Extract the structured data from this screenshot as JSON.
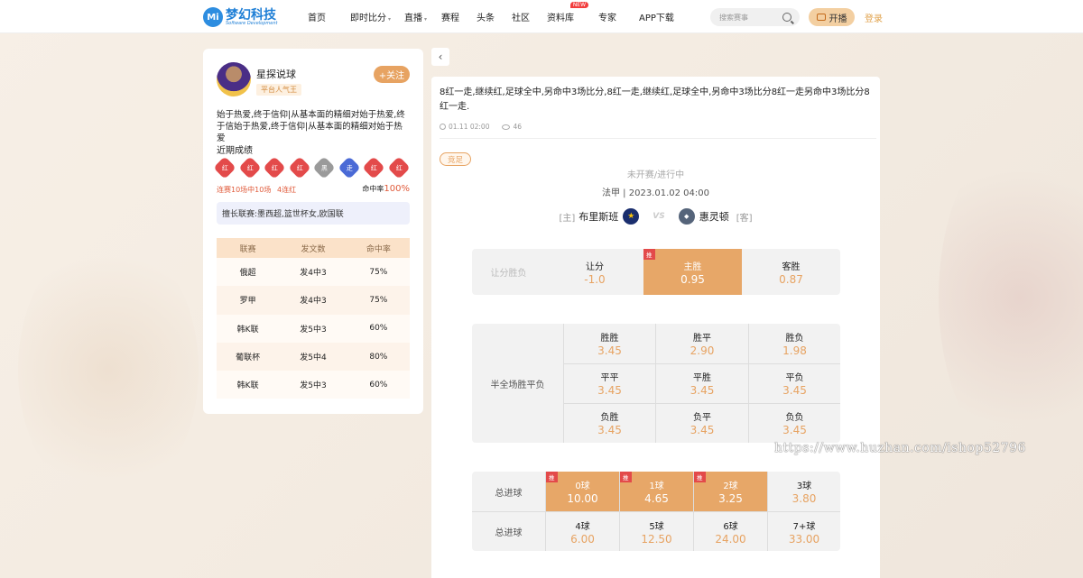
{
  "header": {
    "logo_cn": "梦幻科技",
    "logo_en": "Software Development",
    "logo_mark": "Mi",
    "nav": [
      {
        "label": "首页",
        "caret": false,
        "badge": ""
      },
      {
        "label": "即时比分",
        "caret": true,
        "badge": ""
      },
      {
        "label": "直播",
        "caret": true,
        "badge": ""
      },
      {
        "label": "赛程",
        "caret": false,
        "badge": ""
      },
      {
        "label": "头条",
        "caret": false,
        "badge": ""
      },
      {
        "label": "社区",
        "caret": false,
        "badge": ""
      },
      {
        "label": "资料库",
        "caret": false,
        "badge": "NEW"
      },
      {
        "label": "专家",
        "caret": false,
        "badge": ""
      },
      {
        "label": "APP下载",
        "caret": false,
        "badge": ""
      }
    ],
    "search_placeholder": "搜索赛事",
    "live_label": "开播",
    "login_label": "登录"
  },
  "author": {
    "name": "星探说球",
    "tag": "平台人气王",
    "follow_label": "+关注",
    "bio": "始于热爱,终于信仰|从基本面的精细对始于热爱,终于信始于热爱,终于信仰|从基本面的精细对始于热爱",
    "recent_title": "近期成绩",
    "recent_results": [
      {
        "label": "红",
        "color": "red"
      },
      {
        "label": "红",
        "color": "red"
      },
      {
        "label": "红",
        "color": "red"
      },
      {
        "label": "红",
        "color": "red"
      },
      {
        "label": "黑",
        "color": "gray"
      },
      {
        "label": "走",
        "color": "blue"
      },
      {
        "label": "红",
        "color": "red"
      },
      {
        "label": "红",
        "color": "red"
      }
    ],
    "streak_text": "连赛10场中10场",
    "consecutive_text": "4连红",
    "hit_rate_label": "命中率",
    "hit_rate_value": "100%",
    "leagues_text": "擅长联赛:墨西超,篮世杯女,欧国联",
    "table_headers": [
      "联赛",
      "发文数",
      "命中率"
    ],
    "table_rows": [
      [
        "俄超",
        "发4中3",
        "75%"
      ],
      [
        "罗甲",
        "发4中3",
        "75%"
      ],
      [
        "韩K联",
        "发5中3",
        "60%"
      ],
      [
        "葡联杯",
        "发5中4",
        "80%"
      ],
      [
        "韩K联",
        "发5中3",
        "60%"
      ]
    ]
  },
  "article": {
    "back_icon": "‹",
    "text": "8红一走,继续红,足球全中,另命中3场比分,8红一走,继续红,足球全中,另命中3场比分8红一走另命中3场比分8红一走.",
    "date": "01.11 02:00",
    "views": "46",
    "type_badge": "竞足",
    "status": "未开赛/进行中",
    "league_time": "法甲 | 2023.01.02 04:00",
    "home_tag": "[主]",
    "home_team": "布里斯班",
    "away_team": "惠灵顿",
    "away_tag": "[客]",
    "vs_label": "VS"
  },
  "odds": {
    "rec_flag": "推",
    "handicap": {
      "row_label": "让分胜负",
      "cells": [
        {
          "label": "让分",
          "value": "-1.0",
          "rec": false
        },
        {
          "label": "主胜",
          "value": "0.95",
          "rec": true
        },
        {
          "label": "客胜",
          "value": "0.87",
          "rec": false
        }
      ]
    },
    "halffull": {
      "row_label": "半全场胜平负",
      "cells": [
        {
          "label": "胜胜",
          "value": "3.45"
        },
        {
          "label": "胜平",
          "value": "2.90"
        },
        {
          "label": "胜负",
          "value": "1.98"
        },
        {
          "label": "平平",
          "value": "3.45"
        },
        {
          "label": "平胜",
          "value": "3.45"
        },
        {
          "label": "平负",
          "value": "3.45"
        },
        {
          "label": "负胜",
          "value": "3.45"
        },
        {
          "label": "负平",
          "value": "3.45"
        },
        {
          "label": "负负",
          "value": "3.45"
        }
      ]
    },
    "totals": {
      "row_label_1": "总进球",
      "row_label_2": "总进球",
      "cells": [
        {
          "label": "0球",
          "value": "10.00",
          "rec": true
        },
        {
          "label": "1球",
          "value": "4.65",
          "rec": true
        },
        {
          "label": "2球",
          "value": "3.25",
          "rec": true
        },
        {
          "label": "3球",
          "value": "3.80",
          "rec": false
        },
        {
          "label": "4球",
          "value": "6.00",
          "rec": false
        },
        {
          "label": "5球",
          "value": "12.50",
          "rec": false
        },
        {
          "label": "6球",
          "value": "24.00",
          "rec": false
        },
        {
          "label": "7+球",
          "value": "33.00",
          "rec": false
        }
      ]
    }
  },
  "watermark": "https://www.huzhan.com/ishop52796"
}
